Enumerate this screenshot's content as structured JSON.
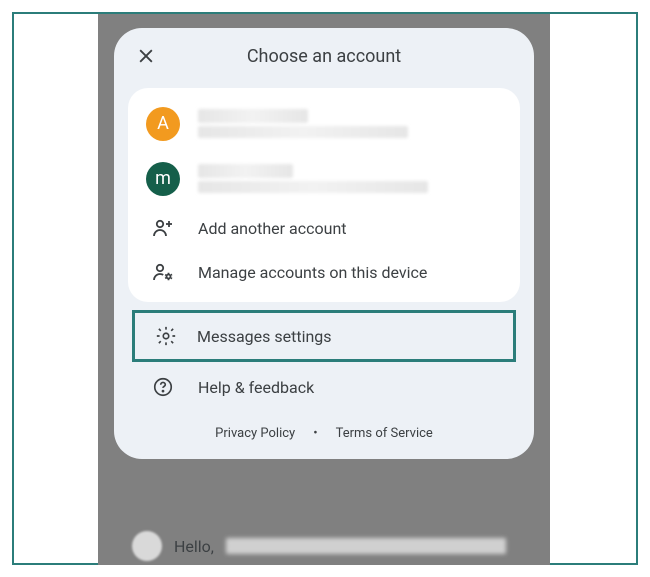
{
  "header": {
    "title": "Choose an account"
  },
  "accounts": [
    {
      "initial": "A"
    },
    {
      "initial": "m"
    }
  ],
  "actions": {
    "add_another": "Add another account",
    "manage": "Manage accounts on this device",
    "settings": "Messages settings",
    "help": "Help & feedback"
  },
  "footer": {
    "privacy": "Privacy Policy",
    "dot": "•",
    "terms": "Terms of Service"
  },
  "background": {
    "hello": "Hello,"
  },
  "highlight": "settings"
}
